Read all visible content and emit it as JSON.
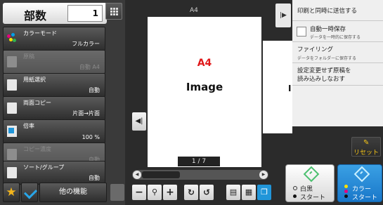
{
  "copies": {
    "label": "部数",
    "value": "1"
  },
  "functions": [
    {
      "label": "カラーモード",
      "value": "フルカラー",
      "enabled": true
    },
    {
      "label": "原稿",
      "value": "自動 A4",
      "enabled": false
    },
    {
      "label": "用紙選択",
      "value": "自動",
      "enabled": true
    },
    {
      "label": "両面コピー",
      "value": "片面→片面",
      "enabled": true
    },
    {
      "label": "倍率",
      "value": "100 %",
      "enabled": true
    },
    {
      "label": "コピー濃度",
      "value": "自動",
      "enabled": false
    },
    {
      "label": "ソート/グループ",
      "value": "自動",
      "enabled": true
    }
  ],
  "bottom": {
    "star_icon": "★",
    "other_label": "他の機能"
  },
  "preview": {
    "paper_size": "A4",
    "page_title": "A4",
    "page_body": "Image",
    "next_page_text": "I",
    "page_counter": "1 / 7"
  },
  "menu": {
    "item1": "印刷と同時に送信する",
    "item2": "自動一時保存",
    "item2_sub": "データを一時的に保存する",
    "item3": "ファイリング",
    "item3_sub": "データをフォルダーに保存する",
    "item4_line1": "設定変更せず原稿を",
    "item4_line2": "読み込みしなおす"
  },
  "reset": {
    "label": "リセット"
  },
  "start_bw": {
    "line1": "白黒",
    "line2": "スタート"
  },
  "start_color": {
    "line1": "カラー",
    "line2": "スタート"
  },
  "colors": {
    "accent": "#2196d9",
    "preview_red": "#e0191b",
    "start_green": "#4cc070",
    "reset_yellow": "#f5c518"
  }
}
